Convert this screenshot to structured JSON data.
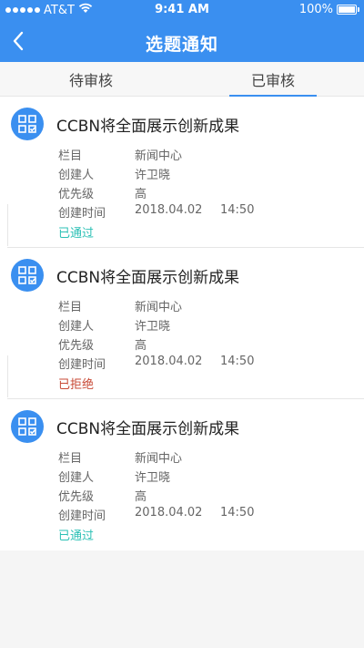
{
  "status_bar": {
    "carrier": "AT&T",
    "time": "9:41 AM",
    "battery": "100%"
  },
  "nav": {
    "title": "选题通知"
  },
  "tabs": [
    {
      "label": "待审核",
      "selected": false
    },
    {
      "label": "已审核",
      "selected": true
    }
  ],
  "labels": {
    "column": "栏目",
    "creator": "创建人",
    "priority": "优先级",
    "created_time": "创建时间"
  },
  "items": [
    {
      "title": "CCBN将全面展示创新成果",
      "column": "新闻中心",
      "creator": "许卫晓",
      "priority": "高",
      "date": "2018.04.02",
      "time": "14:50",
      "status": "已通过",
      "status_type": "pass"
    },
    {
      "title": "CCBN将全面展示创新成果",
      "column": "新闻中心",
      "creator": "许卫晓",
      "priority": "高",
      "date": "2018.04.02",
      "time": "14:50",
      "status": "已拒绝",
      "status_type": "reject"
    },
    {
      "title": "CCBN将全面展示创新成果",
      "column": "新闻中心",
      "creator": "许卫晓",
      "priority": "高",
      "date": "2018.04.02",
      "time": "14:50",
      "status": "已通过",
      "status_type": "pass"
    }
  ],
  "colors": {
    "primary": "#3a8ff0",
    "pass": "#2bc0b5",
    "reject": "#c84a36"
  },
  "icons": {
    "back": "chevron-left-icon",
    "item": "grid-check-icon",
    "wifi": "wifi-icon",
    "battery": "battery-icon"
  }
}
